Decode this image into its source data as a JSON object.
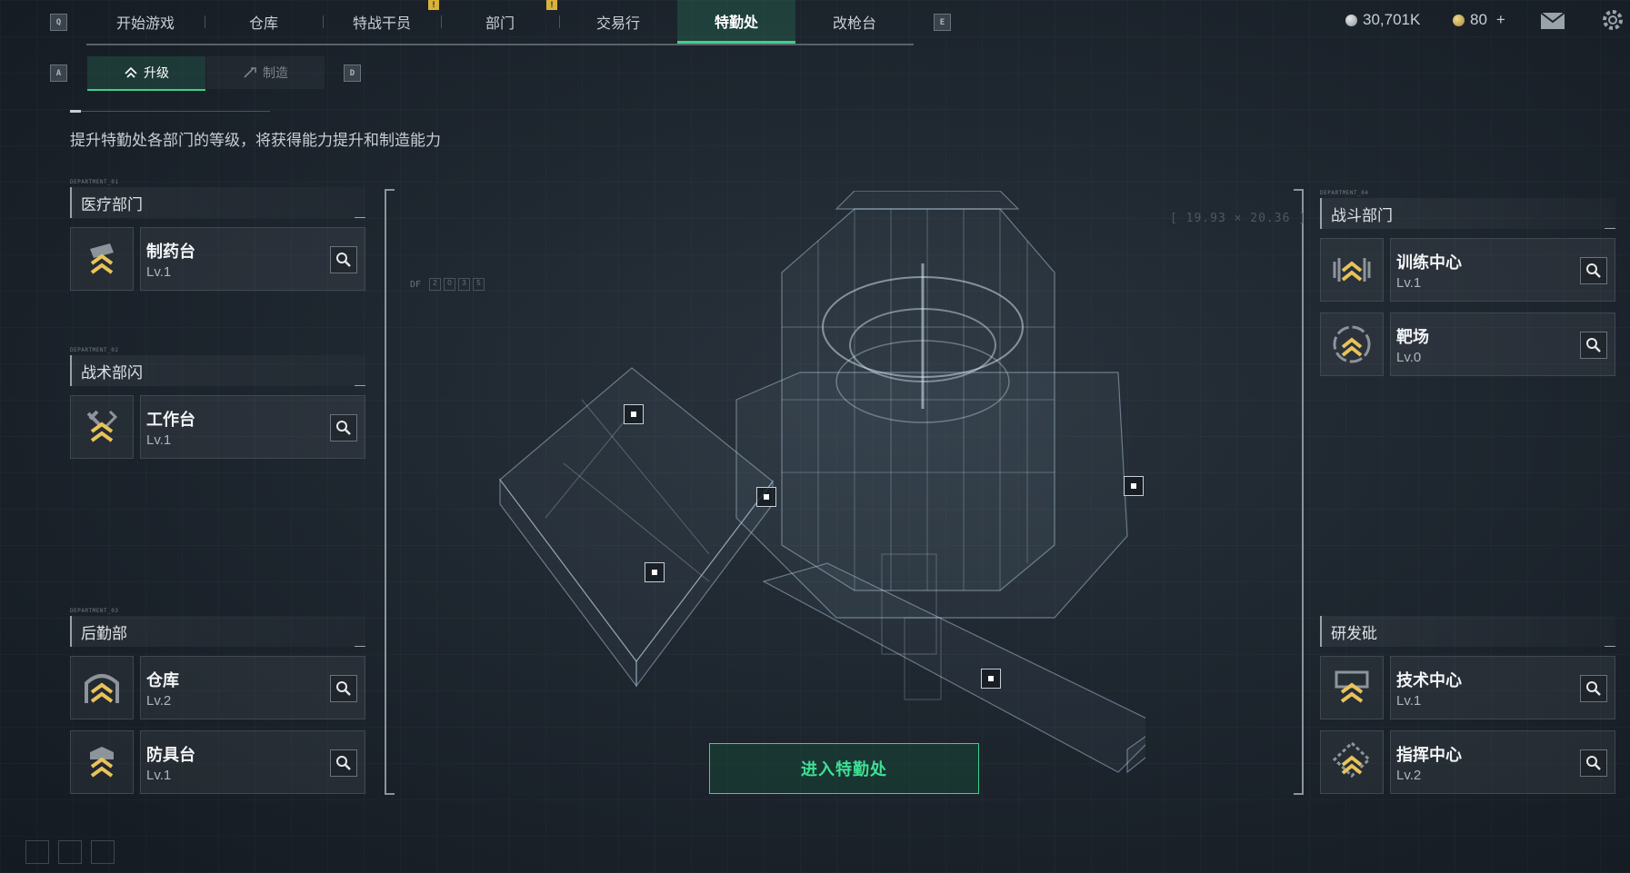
{
  "nav": {
    "left_key": "Q",
    "right_key": "E",
    "tabs": [
      {
        "label": "开始游戏",
        "alert": false
      },
      {
        "label": "仓库",
        "alert": false
      },
      {
        "label": "特战干员",
        "alert": true
      },
      {
        "label": "部门",
        "alert": false
      },
      {
        "label": "交易行",
        "alert": true
      },
      {
        "label": "特勤处",
        "alert": false,
        "active": true
      },
      {
        "label": "改枪台",
        "alert": false
      }
    ],
    "alert_mark": "!"
  },
  "currency": {
    "silver": "30,701K",
    "gold": "80",
    "gold_add": "+"
  },
  "subtabs": {
    "left_key": "A",
    "right_key": "D",
    "upgrade": "升级",
    "craft": "制造"
  },
  "description": "提升特勤处各部门的等级，将获得能力提升和制造能力",
  "departments": {
    "medical": {
      "tag": "DEPARTMENT_01",
      "title": "医疗部门",
      "items": [
        {
          "name": "制药台",
          "level": "Lv.1"
        }
      ]
    },
    "tactical": {
      "tag": "DEPARTMENT_02",
      "title": "战术部闪",
      "items": [
        {
          "name": "工作台",
          "level": "Lv.1"
        }
      ]
    },
    "logistics": {
      "tag": "DEPARTMENT_03",
      "title": "后勤部",
      "items": [
        {
          "name": "仓库",
          "level": "Lv.2"
        },
        {
          "name": "防具台",
          "level": "Lv.1"
        }
      ]
    },
    "combat": {
      "tag": "DEPARTMENT_04",
      "title": "战斗部门",
      "items": [
        {
          "name": "训练中心",
          "level": "Lv.1"
        },
        {
          "name": "靶场",
          "level": "Lv.0"
        }
      ]
    },
    "research": {
      "title": "研发砒",
      "items": [
        {
          "name": "技术中心",
          "level": "Lv.1"
        },
        {
          "name": "指挥中心",
          "level": "Lv.2"
        }
      ]
    }
  },
  "hud": {
    "coordinates": "[ 19.93 × 20.36 ]",
    "df_label": "DF",
    "df_cells": [
      "2",
      "0",
      "3",
      "5"
    ]
  },
  "enter_button": "进入特勤处",
  "colors": {
    "accent": "#3fd08a",
    "chevron": "#e8c35a",
    "alert": "#d9b23a"
  }
}
